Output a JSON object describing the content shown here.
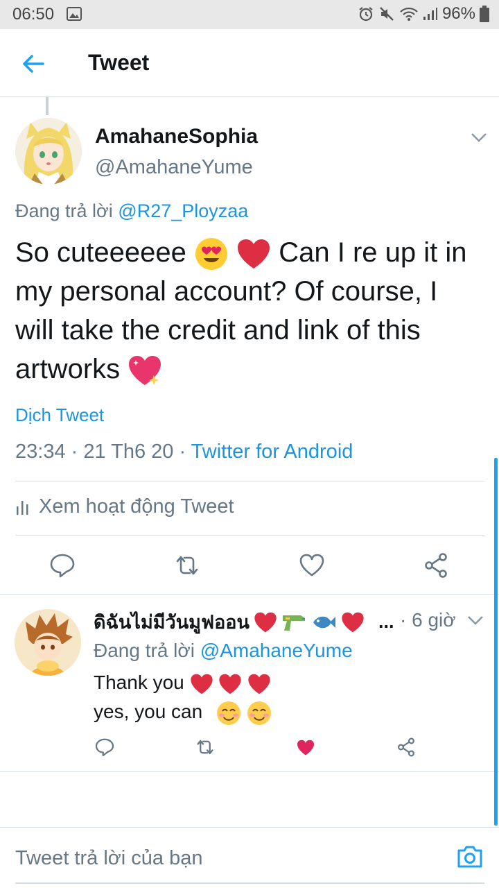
{
  "status_bar": {
    "time": "06:50",
    "battery": "96%"
  },
  "header": {
    "title": "Tweet"
  },
  "main_tweet": {
    "display_name": "AmahaneSophia",
    "handle": "@AmahaneYume",
    "replying_prefix": "Đang trả lời",
    "replying_to": "@R27_Ployzaa",
    "text_part1": "So cuteeeeee",
    "text_part2": "Can I re up it in my personal account? Of course, I will take the credit and link of this artworks",
    "translate_label": "Dịch Tweet",
    "timestamp": "23:34 · 21 Th6 20 · ",
    "source": "Twitter for Android",
    "activity_label": "Xem hoạt động Tweet"
  },
  "reply_tweet": {
    "display_name": "ดิฉันไม่มีวันมูฟออน",
    "ellipsis": "...",
    "time": "· 6 giờ",
    "replying_prefix": "Đang trả lời",
    "replying_to": "@AmahaneYume",
    "line1": "Thank you",
    "line2": "yes, you can"
  },
  "compose": {
    "placeholder": "Tweet trả lời của bạn"
  },
  "colors": {
    "accent": "#1da1f2",
    "link": "#1b95e0",
    "secondary_text": "#657786",
    "like_active": "#e0245e",
    "heart_emoji": "#dd2e44"
  },
  "icons": {
    "back": "arrow-left-icon",
    "menu": "chevron-down-icon",
    "reply": "comment-icon",
    "retweet": "retweet-icon",
    "like": "heart-icon",
    "share": "share-icon",
    "activity": "bar-chart-icon",
    "camera": "camera-icon"
  }
}
